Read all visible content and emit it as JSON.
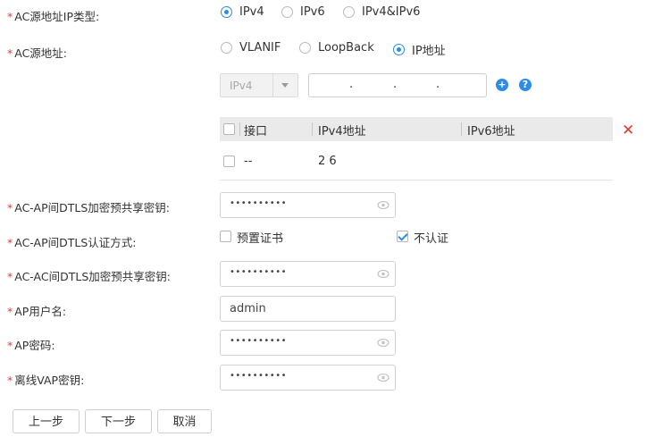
{
  "form": {
    "ip_type": {
      "required": "*",
      "label": "AC源地址IP类型:",
      "options": [
        "IPv4",
        "IPv6",
        "IPv4&IPv6"
      ],
      "selected": "IPv4"
    },
    "source_addr": {
      "required": "*",
      "label": "AC源地址:",
      "options": [
        "VLANIF",
        "LoopBack",
        "IP地址"
      ],
      "selected": "IP地址"
    },
    "ip_select": {
      "value": "IPv4"
    },
    "ip_input": {
      "dots": [
        ".",
        ".",
        "."
      ]
    },
    "table": {
      "headers": [
        "接口",
        "IPv4地址",
        "IPv6地址"
      ],
      "rows": [
        {
          "interface": "--",
          "ipv4": "2 6",
          "ipv6": ""
        }
      ]
    },
    "dtls_psk": {
      "required": "*",
      "label": "AC-AP间DTLS加密预共享密钥:",
      "masked": "••••••••••"
    },
    "dtls_auth": {
      "required": "*",
      "label": "AC-AP间DTLS认证方式:",
      "options": [
        {
          "text": "预置证书",
          "checked": false
        },
        {
          "text": "不认证",
          "checked": true
        }
      ]
    },
    "acac_psk": {
      "required": "*",
      "label": "AC-AC间DTLS加密预共享密钥:",
      "masked": "••••••••••"
    },
    "ap_user": {
      "required": "*",
      "label": "AP用户名:",
      "value": "admin"
    },
    "ap_pass": {
      "required": "*",
      "label": "AP密码:",
      "masked": "••••••••••"
    },
    "vap_key": {
      "required": "*",
      "label": "离线VAP密钥:",
      "masked": "••••••••••"
    }
  },
  "buttons": {
    "prev": "上一步",
    "next": "下一步",
    "cancel": "取消"
  },
  "icons": {
    "add": "plus-circle-icon",
    "help": "question-circle-icon",
    "delete": "close-icon",
    "eye": "eye-icon"
  },
  "colors": {
    "accent": "#2d8ce3",
    "required": "#e83a3a",
    "delete": "#e03a2f"
  }
}
